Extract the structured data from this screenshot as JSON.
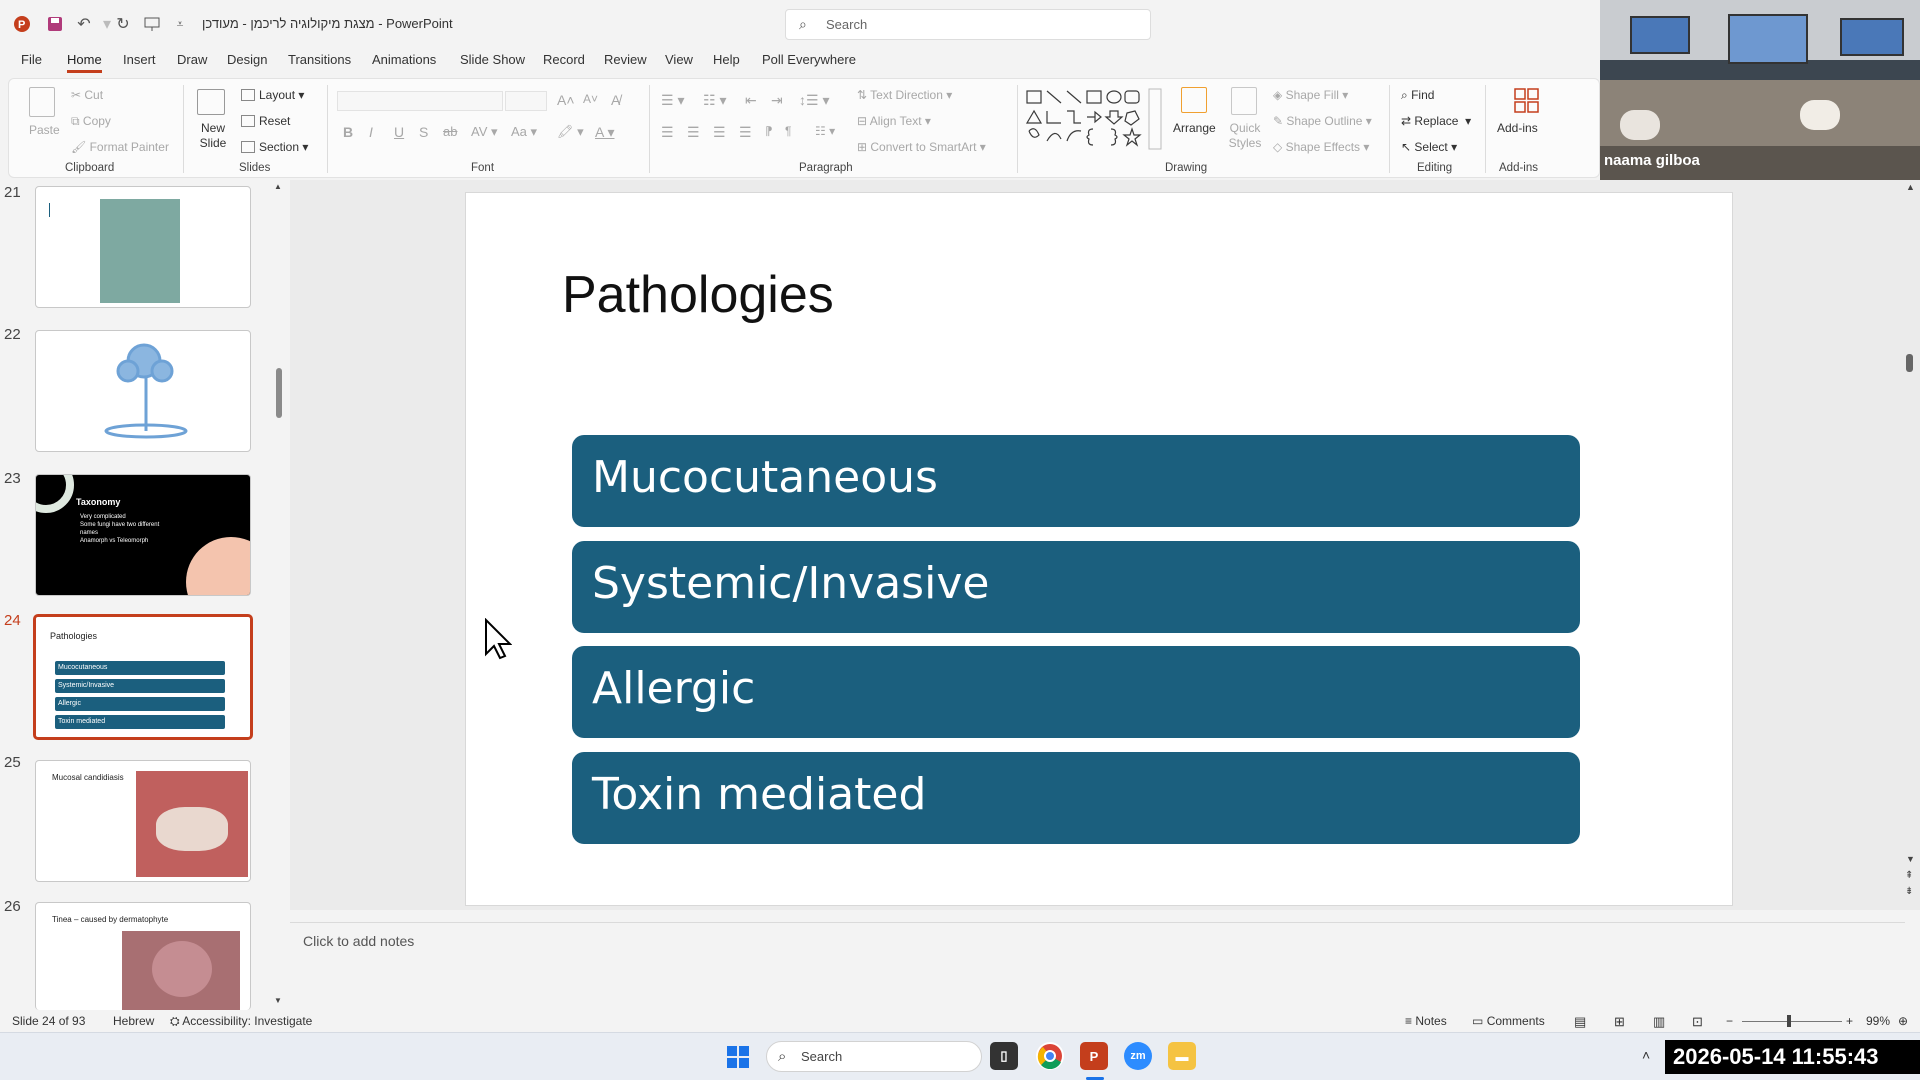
{
  "window": {
    "title": "מצגת מיקולוגיה לריכמן - מעודכן  -  PowerPoint",
    "search_placeholder": "Search"
  },
  "menu_tabs": [
    "File",
    "Home",
    "Insert",
    "Draw",
    "Design",
    "Transitions",
    "Animations",
    "Slide Show",
    "Record",
    "Review",
    "View",
    "Help",
    "Poll Everywhere"
  ],
  "ribbon": {
    "clipboard": {
      "label": "Clipboard",
      "paste": "Paste",
      "cut": "Cut",
      "copy": "Copy",
      "format_painter": "Format Painter"
    },
    "slides": {
      "label": "Slides",
      "new_slide": "New Slide",
      "layout": "Layout",
      "reset": "Reset",
      "section": "Section"
    },
    "font": {
      "label": "Font"
    },
    "paragraph": {
      "label": "Paragraph",
      "text_direction": "Text Direction",
      "align_text": "Align Text",
      "convert_smartart": "Convert to SmartArt"
    },
    "drawing": {
      "label": "Drawing",
      "arrange": "Arrange",
      "quick_styles": "Quick Styles",
      "shape_fill": "Shape Fill",
      "shape_outline": "Shape Outline",
      "shape_effects": "Shape Effects"
    },
    "editing": {
      "label": "Editing",
      "find": "Find",
      "replace": "Replace",
      "select": "Select"
    },
    "addins": {
      "label": "Add-ins",
      "addins": "Add-ins"
    }
  },
  "video": {
    "participant": "naama gilboa"
  },
  "thumbnails": [
    {
      "num": "21",
      "title": ""
    },
    {
      "num": "22",
      "title": ""
    },
    {
      "num": "23",
      "title": "Taxonomy",
      "bullets": [
        "Very complicated",
        "Some fungi have two different names",
        "Anamorph vs Teleomorph"
      ]
    },
    {
      "num": "24",
      "title": "Pathologies",
      "items": [
        "Mucocutaneous",
        "Systemic/Invasive",
        "Allergic",
        "Toxin mediated"
      ]
    },
    {
      "num": "25",
      "title": "Mucosal candidiasis"
    },
    {
      "num": "26",
      "title": "Tinea – caused by dermatophyte"
    }
  ],
  "slide": {
    "title": "Pathologies",
    "items": [
      "Mucocutaneous",
      "Systemic/Invasive",
      "Allergic",
      "Toxin mediated"
    ],
    "box_color": "#1b5f7e"
  },
  "notes": {
    "placeholder": "Click to add notes"
  },
  "statusbar": {
    "slide_counter": "Slide 24 of 93",
    "language": "Hebrew",
    "accessibility": "Accessibility: Investigate",
    "notes": "Notes",
    "comments": "Comments",
    "zoom": "99%"
  },
  "taskbar": {
    "search": "Search",
    "clock": "2026-05-14 11:55:43"
  },
  "colors": {
    "accent": "#c43e1c",
    "slide_box": "#1b5f7e"
  }
}
